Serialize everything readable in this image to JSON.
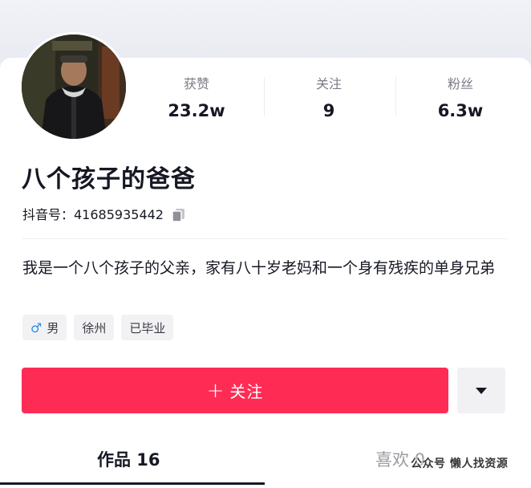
{
  "profile": {
    "name": "八个孩子的爸爸",
    "douyin_id": "抖音号：41685935442",
    "bio": "我是一个八个孩子的父亲，家有八十岁老妈和一个身有残疾的单身兄弟",
    "tags": [
      {
        "label": "男",
        "icon": "male-icon"
      },
      {
        "label": "徐州"
      },
      {
        "label": "已毕业"
      }
    ]
  },
  "stats": [
    {
      "label": "获赞",
      "value": "23.2w"
    },
    {
      "label": "关注",
      "value": "9"
    },
    {
      "label": "粉丝",
      "value": "6.3w"
    }
  ],
  "actions": {
    "follow_label": "关注",
    "follow_icon": "plus-icon",
    "dropdown_icon": "caret-down-icon"
  },
  "tabs": [
    {
      "label": "作品 16",
      "active": true
    },
    {
      "label": "喜欢 0",
      "active": false
    }
  ],
  "watermark": "公众号  懒人找资源",
  "colors": {
    "accent": "#fe2c55",
    "male": "#2b8ef0",
    "text": "#161823",
    "muted": "#7a7c85"
  }
}
